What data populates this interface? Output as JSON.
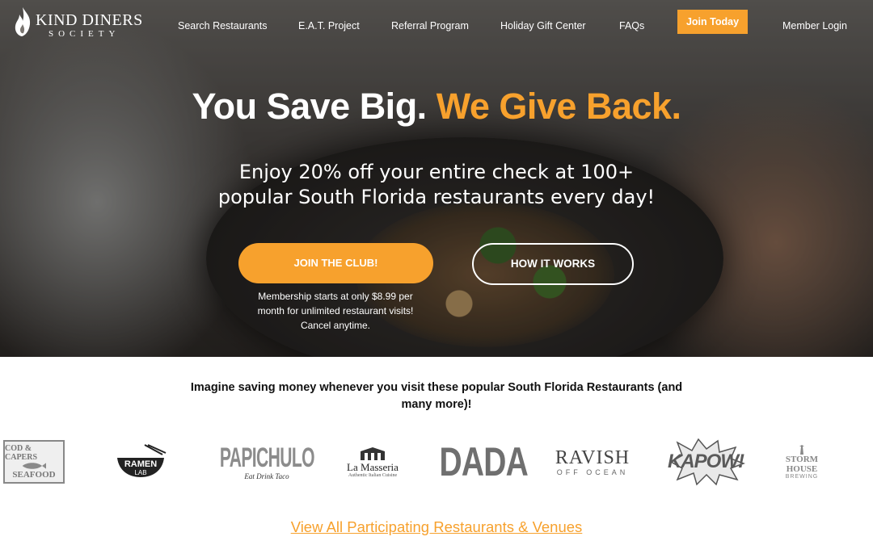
{
  "brand": {
    "line1": "KIND DINERS",
    "line2": "SOCIETY",
    "logo_icon": "flame-icon"
  },
  "nav": {
    "items": [
      {
        "label": "Search Restaurants"
      },
      {
        "label": "E.A.T. Project"
      },
      {
        "label": "Referral Program"
      },
      {
        "label": "Holiday Gift Center"
      },
      {
        "label": "FAQs"
      }
    ],
    "join_label": "Join Today",
    "login_label": "Member Login"
  },
  "hero": {
    "headline_white": "You Save Big.",
    "headline_accent": "We Give Back.",
    "subhead_line1": "Enjoy 20% off your entire check at 100+",
    "subhead_line2": "popular South Florida restaurants every day!",
    "cta_primary": "JOIN THE CLUB!",
    "cta_secondary": "HOW IT WORKS",
    "note_line1": "Membership starts at only $8.99 per",
    "note_line2": "month for unlimited restaurant visits!",
    "note_line3": "Cancel anytime."
  },
  "restaurants": {
    "intro_line1": "Imagine saving money whenever you visit these popular South Florida Restaurants (and",
    "intro_line2": "many more)!",
    "logos": [
      {
        "top": "COD & CAPERS",
        "bottom": "SEAFOOD"
      },
      {
        "top": "RAMEN",
        "bottom": "LAB"
      },
      {
        "top": "PAPICHULO",
        "bottom": "Eat Drink Taco"
      },
      {
        "top": "La Masseria",
        "bottom": "Authentic Italian Cuisine"
      },
      {
        "top": "DADA",
        "bottom": ""
      },
      {
        "top": "RAVISH",
        "bottom": "OFF OCEAN"
      },
      {
        "top": "KAPOW!",
        "bottom": ""
      },
      {
        "top": "STORM HOUSE",
        "bottom": "BREWING"
      }
    ],
    "view_all": "View All Participating Restaurants & Venues"
  },
  "colors": {
    "accent": "#f7a12d",
    "text": "#111111",
    "logo_gray": "#6f6f6f"
  }
}
